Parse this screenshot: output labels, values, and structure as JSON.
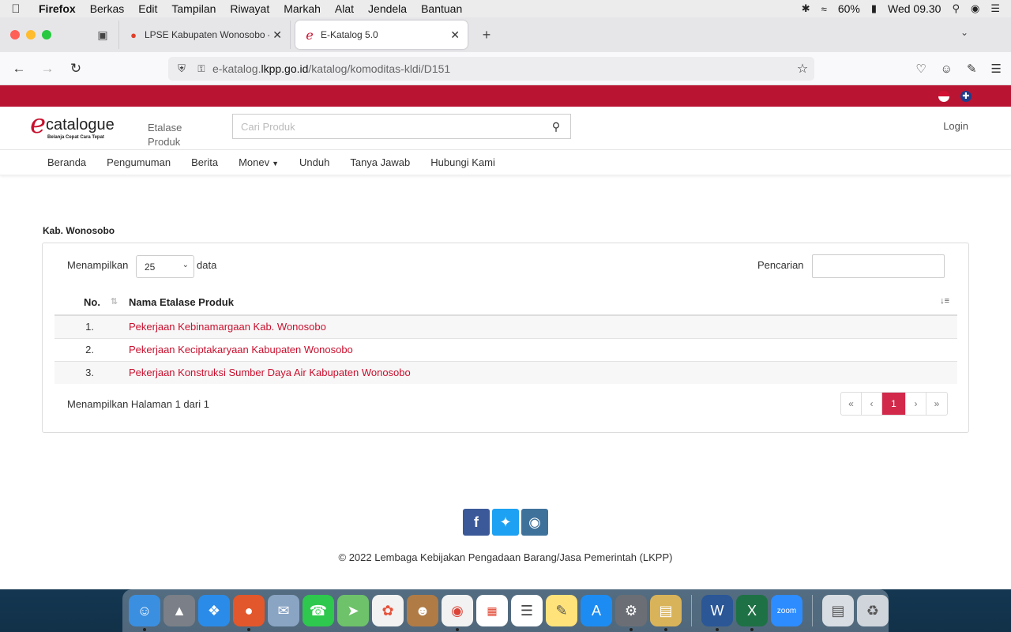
{
  "menubar": {
    "app_name": "Firefox",
    "items": [
      "Berkas",
      "Edit",
      "Tampilan",
      "Riwayat",
      "Markah",
      "Alat",
      "Jendela",
      "Bantuan"
    ],
    "battery": "60%",
    "clock": "Wed 09.30"
  },
  "browser": {
    "tabs": [
      {
        "title": "LPSE Kabupaten Wonosobo - Ho",
        "active": false
      },
      {
        "title": "E-Katalog 5.0",
        "active": true
      }
    ],
    "url": {
      "prefix": "e-katalog.",
      "host": "lkpp.go.id",
      "path": "/katalog/komoditas-kldi/D151"
    }
  },
  "site": {
    "logo_word": "catalogue",
    "logo_e": "e",
    "logo_tagline": "Belanja Cepat Cara Tepat",
    "etalase_link": "Etalase Produk",
    "search_placeholder": "Cari Produk",
    "login_label": "Login",
    "nav": {
      "beranda": "Beranda",
      "pengumuman": "Pengumuman",
      "berita": "Berita",
      "monev": "Monev",
      "unduh": "Unduh",
      "tanya_jawab": "Tanya Jawab",
      "hubungi_kami": "Hubungi Kami"
    }
  },
  "content": {
    "section_title": "Kab. Wonosobo",
    "length_label": "Menampilkan",
    "length_value": "25",
    "length_suffix": "data",
    "search_label": "Pencarian",
    "table": {
      "col_no": "No.",
      "col_name": "Nama Etalase Produk",
      "rows": [
        {
          "no": "1.",
          "name": "Pekerjaan Kebinamargaan Kab. Wonosobo"
        },
        {
          "no": "2.",
          "name": "Pekerjaan Keciptakaryaan Kabupaten Wonosobo"
        },
        {
          "no": "3.",
          "name": "Pekerjaan Konstruksi Sumber Daya Air Kabupaten Wonosobo"
        }
      ]
    },
    "info_text": "Menampilkan Halaman 1 dari 1",
    "pagination": {
      "first": "«",
      "prev": "‹",
      "current": "1",
      "next": "›",
      "last": "»"
    }
  },
  "footer": {
    "copyright": "© 2022 Lembaga Kebijakan Pengadaan Barang/Jasa Pemerintah (LKPP)",
    "social_icons": [
      "facebook-icon",
      "twitter-icon",
      "instagram-icon"
    ]
  },
  "colors": {
    "brand_red": "#b91432",
    "link_red": "#c8102e",
    "pager_active": "#d2294a"
  }
}
